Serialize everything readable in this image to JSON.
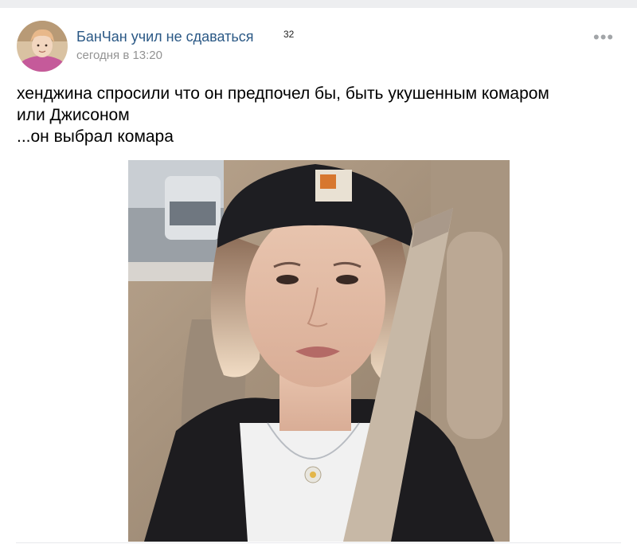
{
  "post": {
    "author": "БанЧан учил не сдаваться",
    "badge": "32",
    "time": "сегодня в 13:20",
    "text_lines": [
      "хенджина спросили что он предпочел бы, быть укушенным комаром",
      "или Джисоном",
      "...он выбрал комара"
    ]
  },
  "icons": {
    "more": "more-dots-icon"
  },
  "colors": {
    "author_link": "#2a5885",
    "meta_gray": "#939393",
    "page_bg": "#edeef0"
  }
}
